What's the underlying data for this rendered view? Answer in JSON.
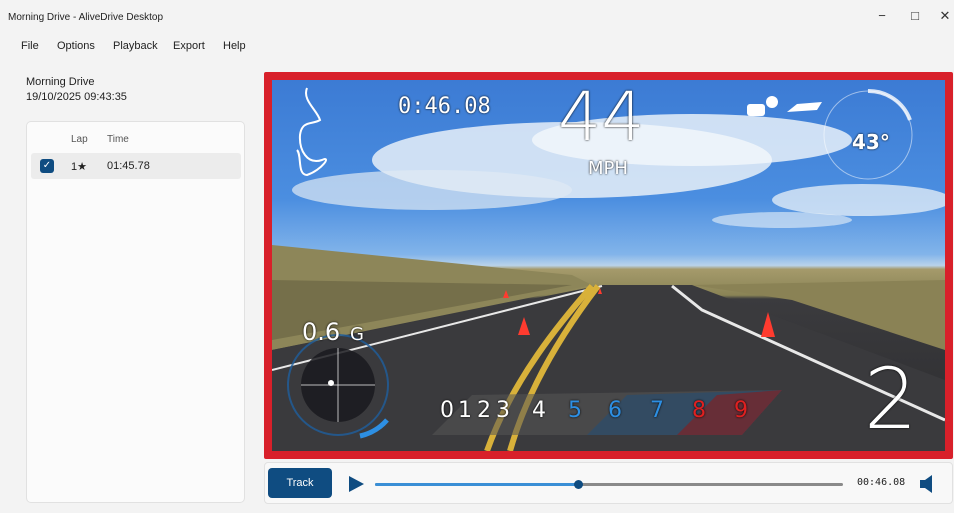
{
  "window": {
    "title": "Morning Drive - AliveDrive Desktop",
    "controls": {
      "minimize": "−",
      "maximize": "□",
      "close": "✕"
    }
  },
  "menu": [
    "File",
    "Options",
    "Playback",
    "Export",
    "Help"
  ],
  "session": {
    "name": "Morning Drive",
    "datetime": "19/10/2025 09:43:35"
  },
  "laps": {
    "headers": {
      "lap": "Lap",
      "time": "Time"
    },
    "rows": [
      {
        "checked": true,
        "lap": "1★",
        "time": "01:45.78"
      }
    ]
  },
  "overlay": {
    "lap_timer": "0:46.08",
    "speed": "44",
    "speed_unit": "MPH",
    "temperature": "43°",
    "g_force_value": "0.6",
    "g_force_unit": "G",
    "current_gear": "2",
    "gears": [
      "0",
      "1",
      "2",
      "3",
      "4",
      "5",
      "6",
      "7",
      "8",
      "9"
    ],
    "gear_colors": {
      "white": "#ffffff",
      "blue": "#2d8fe3",
      "red": "#e02020"
    },
    "icons": [
      "track-map-icon",
      "engine-temp-icon",
      "car-icon",
      "g-meter-icon"
    ]
  },
  "controls": {
    "track_label": "Track",
    "play_icon": "play-icon",
    "volume_icon": "volume-icon",
    "time": "00:46.08",
    "progress": 0.433
  },
  "colors": {
    "accent": "#0f4c81",
    "frame": "#d8202a",
    "seek": "#3a8fd6"
  }
}
